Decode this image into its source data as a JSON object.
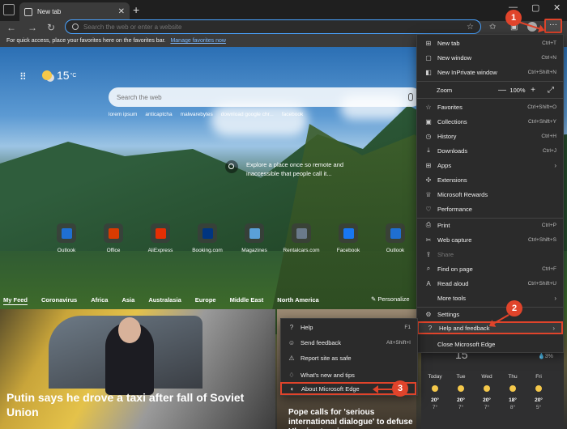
{
  "browser": {
    "tab_title": "New tab",
    "address_placeholder": "Search the web or enter a website",
    "favorites_bar_text": "For quick access, place your favorites here on the favorites bar.",
    "favorites_bar_link": "Manage favorites now"
  },
  "newtab": {
    "temperature": "15",
    "temp_unit": "°C",
    "search_placeholder": "Search the web",
    "suggestions": [
      "lorem ipsum",
      "anticaptcha",
      "malwarebytes",
      "download google chr...",
      "facebook"
    ],
    "explore_text": "Explore a place once so remote and inaccessible that people call it...",
    "quick_links": [
      {
        "name": "Outlook",
        "color": "#1f6fd1"
      },
      {
        "name": "Office",
        "color": "#d83b01"
      },
      {
        "name": "AliExpress",
        "color": "#e62e04"
      },
      {
        "name": "Booking.com",
        "color": "#003580"
      },
      {
        "name": "Magazines",
        "color": "#5aa0d8"
      },
      {
        "name": "Rentalcars.com",
        "color": "#6a7a8a"
      },
      {
        "name": "Facebook",
        "color": "#1877f2"
      },
      {
        "name": "Outlook",
        "color": "#1f6fd1"
      }
    ]
  },
  "feed": {
    "tabs": [
      "My Feed",
      "Coronavirus",
      "Africa",
      "Asia",
      "Australasia",
      "Europe",
      "Middle East",
      "North America"
    ],
    "personalize": "Personalize",
    "main_headline": "Putin says he drove a taxi after fall of Soviet Union",
    "second_headline": "Pope calls for 'serious international dialogue' to defuse Ukraine tensions"
  },
  "weather_card": {
    "temp": "15",
    "rain": "3%",
    "days": [
      {
        "day": "Today",
        "hi": "20°",
        "lo": "7°"
      },
      {
        "day": "Tue",
        "hi": "20°",
        "lo": "7°"
      },
      {
        "day": "Wed",
        "hi": "20°",
        "lo": "7°"
      },
      {
        "day": "Thu",
        "hi": "18°",
        "lo": "8°"
      },
      {
        "day": "Fri",
        "hi": "20°",
        "lo": "5°"
      }
    ]
  },
  "menu": {
    "items": [
      {
        "label": "New tab",
        "shortcut": "Ctrl+T",
        "icon": "new-tab-icon",
        "glyph": "⊞"
      },
      {
        "label": "New window",
        "shortcut": "Ctrl+N",
        "icon": "new-window-icon",
        "glyph": "▢"
      },
      {
        "label": "New InPrivate window",
        "shortcut": "Ctrl+Shift+N",
        "icon": "inprivate-icon",
        "glyph": "◧"
      }
    ],
    "zoom_label": "Zoom",
    "zoom_value": "100%",
    "items2": [
      {
        "label": "Favorites",
        "shortcut": "Ctrl+Shift+O",
        "icon": "favorites-icon",
        "glyph": "☆"
      },
      {
        "label": "Collections",
        "shortcut": "Ctrl+Shift+Y",
        "icon": "collections-icon",
        "glyph": "▣"
      },
      {
        "label": "History",
        "shortcut": "Ctrl+H",
        "icon": "history-icon",
        "glyph": "◷"
      },
      {
        "label": "Downloads",
        "shortcut": "Ctrl+J",
        "icon": "download-icon",
        "glyph": "⤓"
      },
      {
        "label": "Apps",
        "shortcut": "",
        "icon": "apps-icon",
        "glyph": "⊞"
      },
      {
        "label": "Extensions",
        "shortcut": "",
        "icon": "extensions-icon",
        "glyph": "✣"
      },
      {
        "label": "Microsoft Rewards",
        "shortcut": "",
        "icon": "rewards-icon",
        "glyph": "♕"
      },
      {
        "label": "Performance",
        "shortcut": "",
        "icon": "performance-icon",
        "glyph": "♡"
      }
    ],
    "items3": [
      {
        "label": "Print",
        "shortcut": "Ctrl+P",
        "icon": "print-icon",
        "glyph": "⎙"
      },
      {
        "label": "Web capture",
        "shortcut": "Ctrl+Shift+S",
        "icon": "web-capture-icon",
        "glyph": "✂"
      },
      {
        "label": "Share",
        "shortcut": "",
        "icon": "share-icon",
        "glyph": "⇪"
      },
      {
        "label": "Find on page",
        "shortcut": "Ctrl+F",
        "icon": "find-icon",
        "glyph": "⌕"
      },
      {
        "label": "Read aloud",
        "shortcut": "Ctrl+Shift+U",
        "icon": "read-aloud-icon",
        "glyph": "A"
      },
      {
        "label": "More tools",
        "shortcut": "",
        "icon": "more-tools-icon",
        "glyph": ""
      }
    ],
    "settings": "Settings",
    "help_feedback": "Help and feedback",
    "close_edge": "Close Microsoft Edge"
  },
  "help_menu": {
    "items": [
      {
        "label": "Help",
        "shortcut": "F1",
        "icon": "help-icon",
        "glyph": "?"
      },
      {
        "label": "Send feedback",
        "shortcut": "Alt+Shift+I",
        "icon": "feedback-icon",
        "glyph": "☺"
      },
      {
        "label": "Report site as safe",
        "shortcut": "",
        "icon": "report-safe-icon",
        "glyph": "⚠"
      },
      {
        "label": "What's new and tips",
        "shortcut": "",
        "icon": "whats-new-icon",
        "glyph": "♢"
      }
    ],
    "about": "About Microsoft Edge"
  },
  "badges": {
    "one": "1",
    "two": "2",
    "three": "3"
  },
  "colors": {
    "highlight": "#e0442b",
    "accent": "#4aa3ff"
  }
}
